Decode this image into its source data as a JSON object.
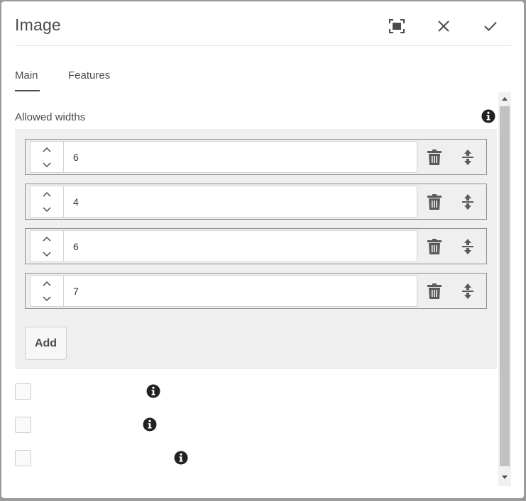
{
  "dialog": {
    "title": "Image",
    "actions": {
      "fullscreen_icon": "fullscreen-icon",
      "close_icon": "close-icon",
      "done_icon": "checkmark-icon"
    }
  },
  "tabs": [
    {
      "label": "Main",
      "active": true
    },
    {
      "label": "Features",
      "active": false
    }
  ],
  "allowed_widths": {
    "label": "Allowed widths",
    "values": [
      "6",
      "4",
      "6",
      "7"
    ],
    "add_label": "Add"
  },
  "checkboxes": [
    {
      "label": "",
      "checked": false
    },
    {
      "label": "",
      "checked": false
    },
    {
      "label": "",
      "checked": false
    }
  ],
  "colors": {
    "accent": "#4b4b4b",
    "multifield_bg": "#efefef",
    "scrollbar_thumb": "#c1c1c1"
  }
}
